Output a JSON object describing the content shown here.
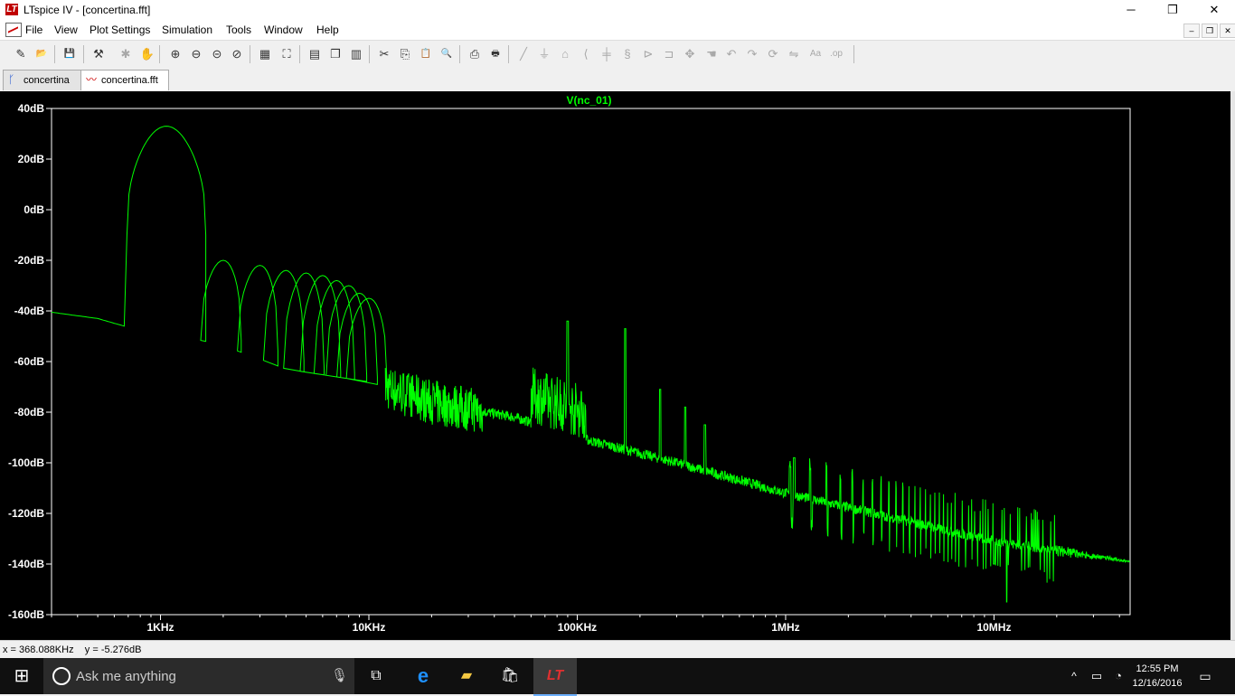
{
  "window": {
    "title": "LTspice IV - [concertina.fft]",
    "minimize": "─",
    "restore": "❐",
    "close": "✕"
  },
  "menu": {
    "items": [
      "File",
      "View",
      "Plot Settings",
      "Simulation",
      "Tools",
      "Window",
      "Help"
    ],
    "mdi": [
      "–",
      "❐",
      "✕"
    ]
  },
  "toolbar": {
    "icons": [
      {
        "name": "new-schematic-icon",
        "glyph": "✎",
        "enabled": true
      },
      {
        "name": "open-icon",
        "glyph": "📂",
        "enabled": true
      },
      {
        "name": "save-icon",
        "glyph": "💾",
        "enabled": true
      },
      {
        "name": "control-panel-icon",
        "glyph": "⚒",
        "enabled": true
      },
      {
        "name": "run-icon",
        "glyph": "✱",
        "enabled": false
      },
      {
        "name": "halt-icon",
        "glyph": "✋",
        "enabled": false
      },
      {
        "name": "zoom-in-icon",
        "glyph": "⊕",
        "enabled": true
      },
      {
        "name": "zoom-back-icon",
        "glyph": "⊖",
        "enabled": true
      },
      {
        "name": "zoom-out-icon",
        "glyph": "⊝",
        "enabled": true
      },
      {
        "name": "zoom-cancel-icon",
        "glyph": "⊘",
        "enabled": true
      },
      {
        "name": "autorange-icon",
        "glyph": "▦",
        "enabled": true
      },
      {
        "name": "zoom-full-icon",
        "glyph": "⛶",
        "enabled": true
      },
      {
        "name": "tile-horizontal-icon",
        "glyph": "▤",
        "enabled": true
      },
      {
        "name": "cascade-icon",
        "glyph": "❐",
        "enabled": true
      },
      {
        "name": "tile-vertical-icon",
        "glyph": "▥",
        "enabled": true
      },
      {
        "name": "cut-icon",
        "glyph": "✂",
        "enabled": true
      },
      {
        "name": "copy-icon",
        "glyph": "⎘",
        "enabled": true
      },
      {
        "name": "paste-icon",
        "glyph": "📋",
        "enabled": true
      },
      {
        "name": "find-icon",
        "glyph": "🔍",
        "enabled": true
      },
      {
        "name": "print-setup-icon",
        "glyph": "⎙",
        "enabled": true
      },
      {
        "name": "print-icon",
        "glyph": "🖶",
        "enabled": true
      },
      {
        "name": "wire-icon",
        "glyph": "╱",
        "enabled": false
      },
      {
        "name": "ground-icon",
        "glyph": "⏚",
        "enabled": false
      },
      {
        "name": "label-net-icon",
        "glyph": "⌂",
        "enabled": false
      },
      {
        "name": "resistor-icon",
        "glyph": "⟨",
        "enabled": false
      },
      {
        "name": "capacitor-icon",
        "glyph": "╪",
        "enabled": false
      },
      {
        "name": "inductor-icon",
        "glyph": "§",
        "enabled": false
      },
      {
        "name": "diode-icon",
        "glyph": "⊳",
        "enabled": false
      },
      {
        "name": "component-icon",
        "glyph": "⊐",
        "enabled": false
      },
      {
        "name": "move-icon",
        "glyph": "✥",
        "enabled": false
      },
      {
        "name": "drag-icon",
        "glyph": "☚",
        "enabled": false
      },
      {
        "name": "undo-icon",
        "glyph": "↶",
        "enabled": false
      },
      {
        "name": "redo-icon",
        "glyph": "↷",
        "enabled": false
      },
      {
        "name": "rotate-icon",
        "glyph": "⟳",
        "enabled": false
      },
      {
        "name": "mirror-icon",
        "glyph": "⇋",
        "enabled": false
      },
      {
        "name": "text-icon",
        "glyph": "Aa",
        "enabled": false
      },
      {
        "name": "spice-directive-icon",
        "glyph": ".op",
        "enabled": false
      }
    ]
  },
  "tabs": [
    {
      "label": "concertina",
      "icon": "schematic-icon",
      "active": false
    },
    {
      "label": "concertina.fft",
      "icon": "waveform-icon",
      "active": true
    }
  ],
  "colors": {
    "plot_background": "#000000",
    "trace": "#00ff00",
    "axis_text": "#ffffff",
    "frame": "#ffffff"
  },
  "chart_data": {
    "type": "line",
    "title": "",
    "series": [
      {
        "name": "V(nc_01)",
        "color": "#00ff00"
      }
    ],
    "x_scale": "log",
    "x_unit": "Hz",
    "x_range_hz": [
      300,
      45000000
    ],
    "x_ticks": [
      {
        "label": "1KHz",
        "value": 1000
      },
      {
        "label": "10KHz",
        "value": 10000
      },
      {
        "label": "100KHz",
        "value": 100000
      },
      {
        "label": "1MHz",
        "value": 1000000
      },
      {
        "label": "10MHz",
        "value": 10000000
      }
    ],
    "y_unit": "dB",
    "y_range": [
      -160,
      40
    ],
    "y_ticks": [
      {
        "label": "40dB",
        "value": 40
      },
      {
        "label": "20dB",
        "value": 20
      },
      {
        "label": "0dB",
        "value": 0
      },
      {
        "label": "-20dB",
        "value": -20
      },
      {
        "label": "-40dB",
        "value": -40
      },
      {
        "label": "-60dB",
        "value": -60
      },
      {
        "label": "-80dB",
        "value": -80
      },
      {
        "label": "-100dB",
        "value": -100
      },
      {
        "label": "-120dB",
        "value": -120
      },
      {
        "label": "-140dB",
        "value": -140
      },
      {
        "label": "-160dB",
        "value": -160
      }
    ],
    "grid": false,
    "floor_points": [
      [
        300,
        -40.5
      ],
      [
        500,
        -43
      ],
      [
        670,
        -46
      ],
      [
        1650,
        -52
      ],
      [
        2200,
        -55
      ],
      [
        3000,
        -59
      ],
      [
        4000,
        -63
      ],
      [
        10000,
        -68
      ],
      [
        20000,
        -76
      ],
      [
        50000,
        -82
      ],
      [
        100000,
        -90
      ],
      [
        300000,
        -100
      ],
      [
        1000000,
        -112
      ],
      [
        3000000,
        -121
      ],
      [
        10000000,
        -131
      ],
      [
        45000000,
        -139
      ]
    ],
    "fundamental": {
      "freq_hz": 1000,
      "peak_db": 33,
      "edges_hz": [
        670,
        1650
      ]
    },
    "harmonic_peaks": [
      {
        "freq_hz": 2000,
        "db": -20
      },
      {
        "freq_hz": 3000,
        "db": -22
      },
      {
        "freq_hz": 4000,
        "db": -24
      },
      {
        "freq_hz": 5000,
        "db": -25
      },
      {
        "freq_hz": 6000,
        "db": -26
      },
      {
        "freq_hz": 7000,
        "db": -28
      },
      {
        "freq_hz": 8000,
        "db": -30
      },
      {
        "freq_hz": 9000,
        "db": -33
      },
      {
        "freq_hz": 10000,
        "db": -35
      }
    ],
    "spur_peaks": [
      {
        "freq_hz": 90000,
        "db": -44
      },
      {
        "freq_hz": 170000,
        "db": -47
      },
      {
        "freq_hz": 250000,
        "db": -71
      },
      {
        "freq_hz": 330000,
        "db": -78
      },
      {
        "freq_hz": 410000,
        "db": -85
      },
      {
        "freq_hz": 1100000,
        "db": -98
      },
      {
        "freq_hz": 10000000,
        "db": -140
      }
    ],
    "min_point": {
      "freq_hz": 11500000,
      "db": -155
    }
  },
  "status": {
    "readout": "x = 368.088KHz    y = -5.276dB"
  },
  "taskbar": {
    "search_placeholder": "Ask me anything",
    "time": "12:55 PM",
    "date": "12/16/2016"
  }
}
